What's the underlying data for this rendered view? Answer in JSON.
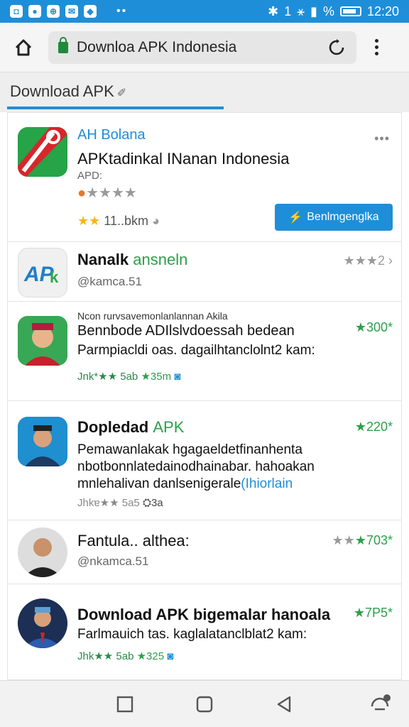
{
  "status": {
    "time": "12:20",
    "battery": "%",
    "signal": "1"
  },
  "browser": {
    "url_text": "Downloa  APK Indonesia"
  },
  "page": {
    "header_title": "Download APK"
  },
  "featured": {
    "developer": "AH Bolana",
    "title": "APKtadinkal INanan Indonesia",
    "subtitle": "APD:",
    "score": "11..bkm",
    "install_label": "Benlmgenglka",
    "more": "•••"
  },
  "apps": [
    {
      "name": "Nanalk",
      "name_accent": "ansneln",
      "sub": "@kamca.51",
      "rating": "2",
      "stars": "★★★"
    },
    {
      "small": "Ncon rurvsavemonlanlannan Akila",
      "name": "Bennbode ADIlslvdoessah bedean",
      "desc": "Parmpiacldi oas. dagailhtanclolnt2 kam:",
      "meta": "Jnk*★★ 5ab",
      "meta2": "★35m",
      "rating": "★300*"
    },
    {
      "name": "Dopledad",
      "name_accent": "APK",
      "desc1": "Pemawanlakak hgagaeldetfinanhenta",
      "desc2": "nbotbonnlatedainodhainabar. hahoakan",
      "desc3": "mnlehalivan danlsenigerale",
      "desc3_accent": "(Ihiorlain",
      "meta": "Jhkɐ★★ 5a5",
      "meta2": "3a",
      "rating": "★220*"
    },
    {
      "name": "Fantula.. althea:",
      "sub": "@nkamca.51",
      "rating": "★703*",
      "stars": "★★"
    },
    {
      "name": "Download APK bigemalar hanoala",
      "desc": "Farlmauich tas. kaglalatanclblat2 kam:",
      "meta": "Jhk★★ 5ab",
      "meta2": "★325",
      "rating": "★7P5*"
    }
  ]
}
